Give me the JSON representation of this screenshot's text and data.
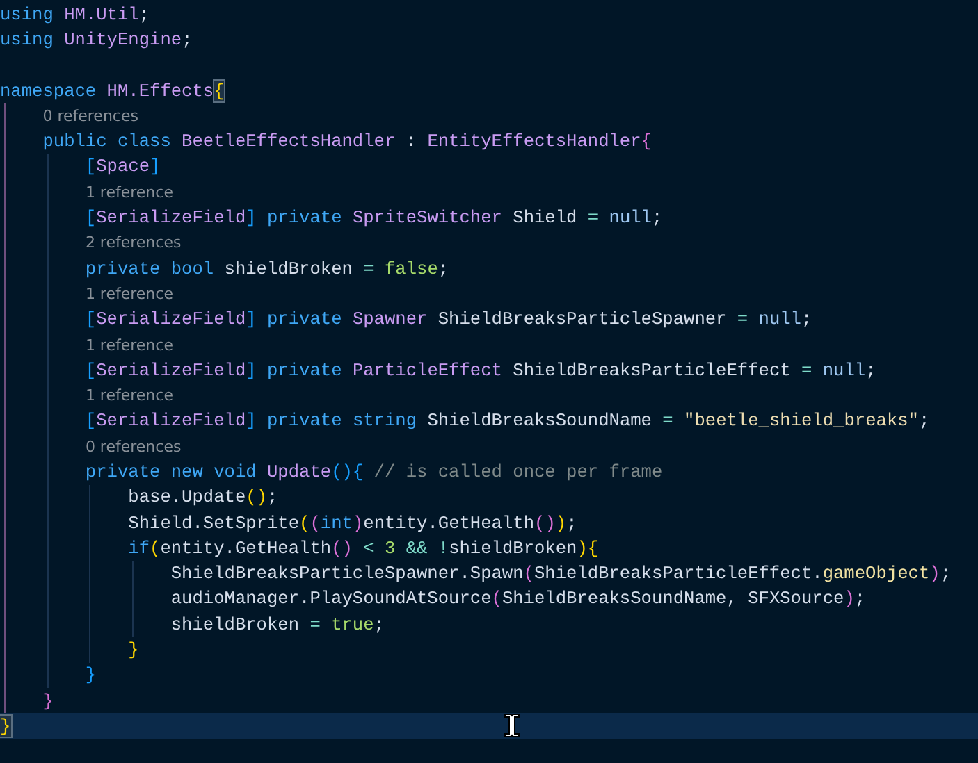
{
  "editor": {
    "lines": [
      {
        "kind": "code",
        "current": false,
        "tokens": [
          {
            "kind": "keyword",
            "text": "using"
          },
          {
            "kind": "type",
            "text": " HM.Util"
          },
          {
            "kind": "plain",
            "text": ";"
          }
        ]
      },
      {
        "kind": "code",
        "current": false,
        "tokens": [
          {
            "kind": "keyword",
            "text": "using"
          },
          {
            "kind": "type",
            "text": " UnityEngine"
          },
          {
            "kind": "plain",
            "text": ";"
          }
        ]
      },
      {
        "kind": "blank",
        "current": false
      },
      {
        "kind": "code",
        "current": false,
        "tokens": [
          {
            "kind": "keyword",
            "text": "namespace"
          },
          {
            "kind": "type",
            "text": " HM.Effects"
          },
          {
            "kind": "brace-match",
            "text": "{"
          }
        ]
      },
      {
        "kind": "lens",
        "current": false,
        "text": "0 references"
      },
      {
        "kind": "code",
        "current": false,
        "tokens": [
          {
            "kind": "keyword",
            "text": "    public class"
          },
          {
            "kind": "type",
            "text": " BeetleEffectsHandler"
          },
          {
            "kind": "plain",
            "text": " : "
          },
          {
            "kind": "type",
            "text": "EntityEffectsHandler"
          },
          {
            "kind": "bracket-2",
            "text": "{"
          }
        ]
      },
      {
        "kind": "code",
        "current": false,
        "tokens": [
          {
            "kind": "bracket-3",
            "text": "        ["
          },
          {
            "kind": "type",
            "text": "Space"
          },
          {
            "kind": "bracket-3",
            "text": "]"
          }
        ]
      },
      {
        "kind": "lens",
        "current": false,
        "text": "1 reference"
      },
      {
        "kind": "code",
        "current": false,
        "tokens": [
          {
            "kind": "bracket-3",
            "text": "        ["
          },
          {
            "kind": "type",
            "text": "SerializeField"
          },
          {
            "kind": "bracket-3",
            "text": "]"
          },
          {
            "kind": "keyword",
            "text": " private"
          },
          {
            "kind": "type",
            "text": " SpriteSwitcher"
          },
          {
            "kind": "plain",
            "text": " Shield "
          },
          {
            "kind": "operator",
            "text": "="
          },
          {
            "kind": "null",
            "text": " null"
          },
          {
            "kind": "plain",
            "text": ";"
          }
        ]
      },
      {
        "kind": "lens",
        "current": false,
        "text": "2 references"
      },
      {
        "kind": "code",
        "current": false,
        "tokens": [
          {
            "kind": "keyword",
            "text": "        private bool"
          },
          {
            "kind": "plain",
            "text": " shieldBroken "
          },
          {
            "kind": "operator",
            "text": "="
          },
          {
            "kind": "literal",
            "text": " false"
          },
          {
            "kind": "plain",
            "text": ";"
          }
        ]
      },
      {
        "kind": "lens",
        "current": false,
        "text": "1 reference"
      },
      {
        "kind": "code",
        "current": false,
        "tokens": [
          {
            "kind": "bracket-3",
            "text": "        ["
          },
          {
            "kind": "type",
            "text": "SerializeField"
          },
          {
            "kind": "bracket-3",
            "text": "]"
          },
          {
            "kind": "keyword",
            "text": " private"
          },
          {
            "kind": "type",
            "text": " Spawner"
          },
          {
            "kind": "plain",
            "text": " ShieldBreaksParticleSpawner "
          },
          {
            "kind": "operator",
            "text": "="
          },
          {
            "kind": "null",
            "text": " null"
          },
          {
            "kind": "plain",
            "text": ";"
          }
        ]
      },
      {
        "kind": "lens",
        "current": false,
        "text": "1 reference"
      },
      {
        "kind": "code",
        "current": false,
        "tokens": [
          {
            "kind": "bracket-3",
            "text": "        ["
          },
          {
            "kind": "type",
            "text": "SerializeField"
          },
          {
            "kind": "bracket-3",
            "text": "]"
          },
          {
            "kind": "keyword",
            "text": " private"
          },
          {
            "kind": "type",
            "text": " ParticleEffect"
          },
          {
            "kind": "plain",
            "text": " ShieldBreaksParticleEffect "
          },
          {
            "kind": "operator",
            "text": "="
          },
          {
            "kind": "null",
            "text": " null"
          },
          {
            "kind": "plain",
            "text": ";"
          }
        ]
      },
      {
        "kind": "lens",
        "current": false,
        "text": "1 reference"
      },
      {
        "kind": "code",
        "current": false,
        "tokens": [
          {
            "kind": "bracket-3",
            "text": "        ["
          },
          {
            "kind": "type",
            "text": "SerializeField"
          },
          {
            "kind": "bracket-3",
            "text": "]"
          },
          {
            "kind": "keyword",
            "text": " private string"
          },
          {
            "kind": "plain",
            "text": " ShieldBreaksSoundName "
          },
          {
            "kind": "operator",
            "text": "="
          },
          {
            "kind": "string",
            "text": " \"beetle_shield_breaks\""
          },
          {
            "kind": "plain",
            "text": ";"
          }
        ]
      },
      {
        "kind": "lens",
        "current": false,
        "text": "0 references"
      },
      {
        "kind": "code",
        "current": false,
        "tokens": [
          {
            "kind": "keyword",
            "text": "        private new void"
          },
          {
            "kind": "type",
            "text": " Update"
          },
          {
            "kind": "bracket-3",
            "text": "(){"
          },
          {
            "kind": "comment",
            "text": " // is called once per frame"
          }
        ]
      },
      {
        "kind": "code",
        "current": false,
        "tokens": [
          {
            "kind": "plain",
            "text": "            base.Update"
          },
          {
            "kind": "bracket-1",
            "text": "()"
          },
          {
            "kind": "plain",
            "text": ";"
          }
        ]
      },
      {
        "kind": "code",
        "current": false,
        "tokens": [
          {
            "kind": "plain",
            "text": "            Shield.SetSprite"
          },
          {
            "kind": "bracket-1",
            "text": "("
          },
          {
            "kind": "bracket-2",
            "text": "("
          },
          {
            "kind": "keyword",
            "text": "int"
          },
          {
            "kind": "bracket-2",
            "text": ")"
          },
          {
            "kind": "plain",
            "text": "entity.GetHealth"
          },
          {
            "kind": "bracket-2",
            "text": "()"
          },
          {
            "kind": "bracket-1",
            "text": ")"
          },
          {
            "kind": "plain",
            "text": ";"
          }
        ]
      },
      {
        "kind": "code",
        "current": false,
        "tokens": [
          {
            "kind": "keyword",
            "text": "            if"
          },
          {
            "kind": "bracket-1",
            "text": "("
          },
          {
            "kind": "plain",
            "text": "entity.GetHealth"
          },
          {
            "kind": "bracket-2",
            "text": "()"
          },
          {
            "kind": "operator",
            "text": " <"
          },
          {
            "kind": "literal",
            "text": " 3"
          },
          {
            "kind": "operator",
            "text": " && !"
          },
          {
            "kind": "plain",
            "text": "shieldBroken"
          },
          {
            "kind": "bracket-1",
            "text": "){"
          }
        ]
      },
      {
        "kind": "code",
        "current": false,
        "tokens": [
          {
            "kind": "plain",
            "text": "                ShieldBreaksParticleSpawner.Spawn"
          },
          {
            "kind": "bracket-2",
            "text": "("
          },
          {
            "kind": "plain",
            "text": "ShieldBreaksParticleEffect."
          },
          {
            "kind": "member",
            "text": "gameObject"
          },
          {
            "kind": "bracket-2",
            "text": ")"
          },
          {
            "kind": "plain",
            "text": ";"
          }
        ]
      },
      {
        "kind": "code",
        "current": false,
        "tokens": [
          {
            "kind": "plain",
            "text": "                audioManager.PlaySoundAtSource"
          },
          {
            "kind": "bracket-2",
            "text": "("
          },
          {
            "kind": "plain",
            "text": "ShieldBreaksSoundName, SFXSource"
          },
          {
            "kind": "bracket-2",
            "text": ")"
          },
          {
            "kind": "plain",
            "text": ";"
          }
        ]
      },
      {
        "kind": "code",
        "current": false,
        "tokens": [
          {
            "kind": "plain",
            "text": "                shieldBroken "
          },
          {
            "kind": "operator",
            "text": "="
          },
          {
            "kind": "literal",
            "text": " true"
          },
          {
            "kind": "plain",
            "text": ";"
          }
        ]
      },
      {
        "kind": "code",
        "current": false,
        "tokens": [
          {
            "kind": "bracket-1",
            "text": "            }"
          }
        ]
      },
      {
        "kind": "code",
        "current": false,
        "tokens": [
          {
            "kind": "bracket-3",
            "text": "        }"
          }
        ]
      },
      {
        "kind": "code",
        "current": false,
        "tokens": [
          {
            "kind": "bracket-2",
            "text": "    }"
          }
        ]
      },
      {
        "kind": "code",
        "current": true,
        "tokens": [
          {
            "kind": "brace-match",
            "text": "}"
          }
        ]
      }
    ]
  }
}
